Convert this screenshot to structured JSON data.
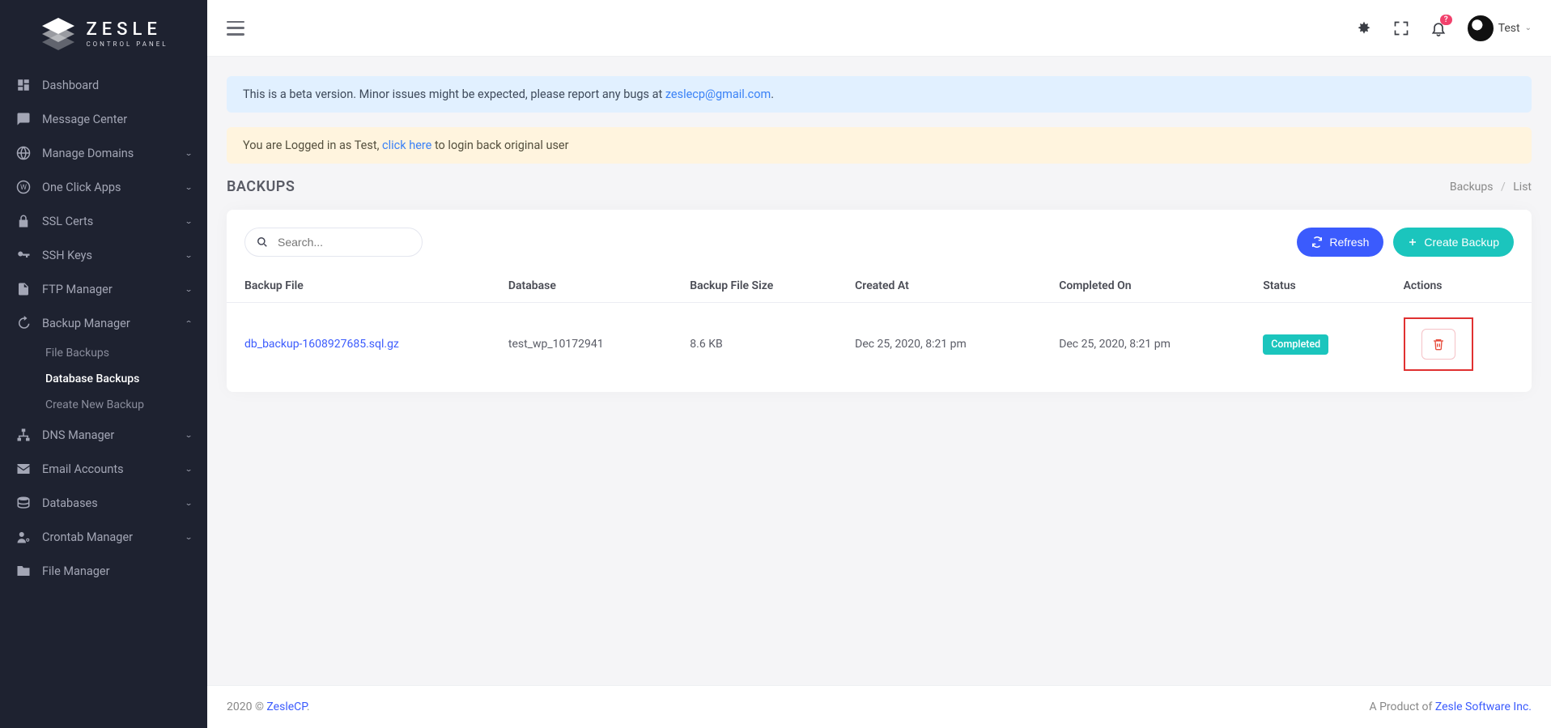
{
  "logo": {
    "brand": "ZESLE",
    "sub": "CONTROL PANEL"
  },
  "sidebar": {
    "items": [
      {
        "label": "Dashboard",
        "icon": "dashboard"
      },
      {
        "label": "Message Center",
        "icon": "message"
      },
      {
        "label": "Manage Domains",
        "icon": "globe",
        "expandable": true
      },
      {
        "label": "One Click Apps",
        "icon": "wordpress",
        "expandable": true
      },
      {
        "label": "SSL Certs",
        "icon": "lock",
        "expandable": true
      },
      {
        "label": "SSH Keys",
        "icon": "key",
        "expandable": true
      },
      {
        "label": "FTP Manager",
        "icon": "file",
        "expandable": true
      },
      {
        "label": "Backup Manager",
        "icon": "history",
        "expandable": true,
        "expanded": true
      },
      {
        "label": "DNS Manager",
        "icon": "sitemap",
        "expandable": true
      },
      {
        "label": "Email Accounts",
        "icon": "mail",
        "expandable": true
      },
      {
        "label": "Databases",
        "icon": "database",
        "expandable": true
      },
      {
        "label": "Crontab Manager",
        "icon": "user-cog",
        "expandable": true
      },
      {
        "label": "File Manager",
        "icon": "folder"
      }
    ],
    "backup_sub": [
      {
        "label": "File Backups"
      },
      {
        "label": "Database Backups"
      },
      {
        "label": "Create New Backup"
      }
    ]
  },
  "topbar": {
    "notif_badge": "?",
    "user_name": "Test"
  },
  "alerts": {
    "beta_pre": "This is a beta version. Minor issues might be expected, please report any bugs at ",
    "beta_link": "zeslecp@gmail.com",
    "login_pre": "You are Logged in as Test, ",
    "login_link": "click here",
    "login_post": " to login back original user"
  },
  "page": {
    "title": "BACKUPS",
    "crumb_parent": "Backups",
    "crumb_current": "List"
  },
  "search": {
    "placeholder": "Search..."
  },
  "buttons": {
    "refresh": "Refresh",
    "create": "Create Backup"
  },
  "table": {
    "headers": [
      "Backup File",
      "Database",
      "Backup File Size",
      "Created At",
      "Completed On",
      "Status",
      "Actions"
    ],
    "rows": [
      {
        "file": "db_backup-1608927685.sql.gz",
        "database": "test_wp_10172941",
        "size": "8.6 KB",
        "created": "Dec 25, 2020, 8:21 pm",
        "completed": "Dec 25, 2020, 8:21 pm",
        "status": "Completed"
      }
    ]
  },
  "footer": {
    "copy_pre": "2020 © ",
    "copy_link": "ZesleCP",
    "copy_post": ".",
    "prod_pre": "A Product of ",
    "prod_link": "Zesle Software Inc."
  }
}
